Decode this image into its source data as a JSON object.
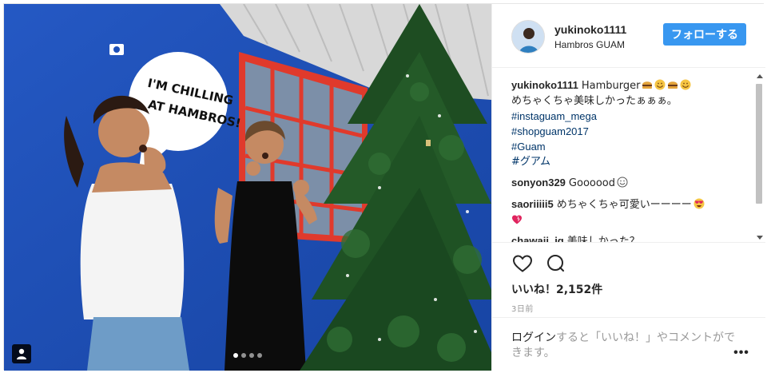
{
  "post": {
    "username": "yukinoko1111",
    "location": "Hambros GUAM",
    "follow_label": "フォローする",
    "caption_text": "Hamburger",
    "caption_line2": "めちゃくちゃ美味しかったぁぁぁ。",
    "hashtags": [
      "#instaguam_mega",
      "#shopguam2017",
      "#Guam",
      "#グアム"
    ],
    "likes": "いいね！2,152件",
    "time": "3日前",
    "login_link": "ログイン",
    "login_rest": "すると「いいね！」やコメントができます。",
    "more_label": "•••"
  },
  "comments": [
    {
      "user": "sonyon329",
      "text": "Goooood"
    },
    {
      "user": "saoriiiii5",
      "text": "めちゃくちゃ可愛いーーーー"
    },
    {
      "user": "chawaii_ig",
      "text": "美味しかった？"
    }
  ],
  "photo": {
    "sign_line1": "I'M CHILLING",
    "sign_line2": "AT HAMBROS!",
    "carousel_slides": 4,
    "active_slide": 1
  },
  "colors": {
    "wall": "#1d4fb8",
    "follow_button": "#3897f0",
    "hashtag": "#003569",
    "window_frame": "#e03a2c"
  },
  "icons": [
    "user-tag-icon",
    "heart-icon",
    "comment-icon",
    "more-icon",
    "hamburger-emoji",
    "smile-emoji",
    "heart-eyes-emoji",
    "heart-emoji"
  ]
}
